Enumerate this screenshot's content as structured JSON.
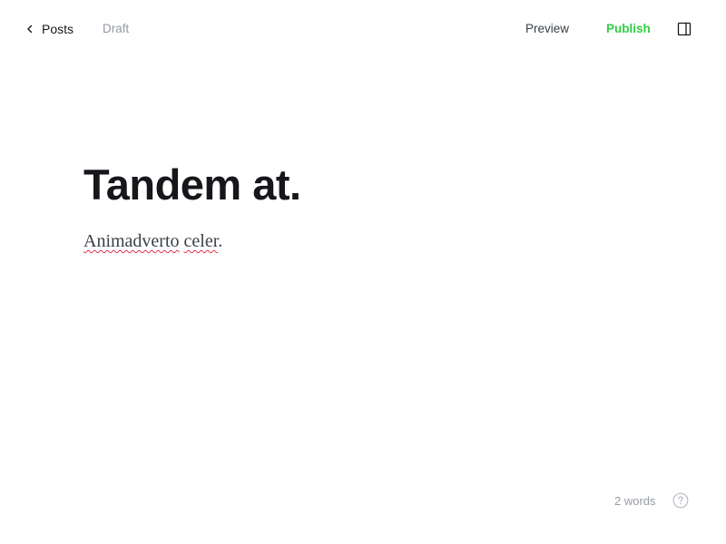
{
  "header": {
    "back_label": "Posts",
    "status": "Draft",
    "preview_label": "Preview",
    "publish_label": "Publish"
  },
  "post": {
    "title": "Tandem at.",
    "body_words": [
      "Animadverto",
      " ",
      "celer",
      "."
    ]
  },
  "footer": {
    "word_count": "2 words"
  },
  "colors": {
    "publish": "#30cf43",
    "muted": "#959aa2",
    "text": "#15171a",
    "spellcheck": "#e0334a"
  },
  "icons": {
    "back": "chevron-left-icon",
    "sidebar": "sidebar-panel-icon",
    "help": "help-circle-icon"
  }
}
